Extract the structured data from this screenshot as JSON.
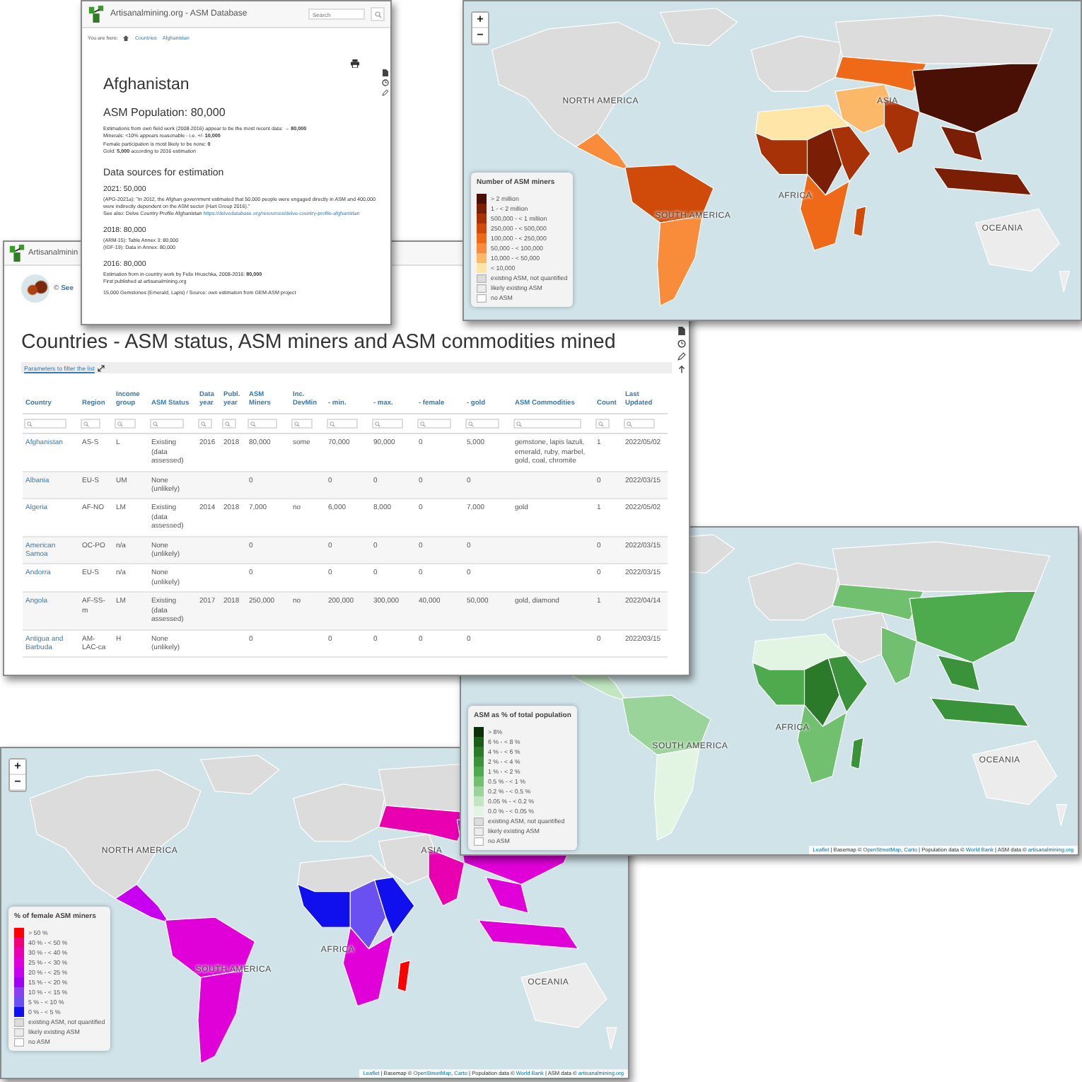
{
  "afghanistan_window": {
    "header": {
      "title": "Artisanalmining.org - ASM Database",
      "search_placeholder": "Search"
    },
    "breadcrumb": {
      "label": "You are here:",
      "links": [
        "Countries",
        "Afghanistan"
      ]
    },
    "heading": "Afghanistan",
    "population_heading": "ASM Population: 80,000",
    "summary": [
      "Estimations from own field work (2008-2016) appear to be the most recent data: → **80,000**",
      "Minerals: <10% appears reasonable - i.e. +/- **10,000**",
      "Female participation is most likely to be none: **0**",
      "Gold: **5,000** according to 2016 estimation"
    ],
    "sources_heading": "Data sources for estimation",
    "sources": [
      {
        "heading": "2021: 50,000",
        "lines": [
          {
            "text": "(APG-2021a): \"In 2012, the Afghan government estimated that 50,000 people were engaged directly in ASM and 400,000 were indirectly dependent on the ASM sector (Hart Group 2016).\""
          },
          {
            "text": "See also: Delve Country Profile Afghanistan",
            "link": "https://delvedatabase.org/resources/delve-country-profile-afghanistan"
          }
        ]
      },
      {
        "heading": "2018: 80,000",
        "lines": [
          {
            "text": "(ARM-15): Table Annex 3: 80,000"
          },
          {
            "text": "(IGF-19): Data in Annex: 80,000"
          }
        ]
      },
      {
        "heading": "2016: 80,000",
        "lines": [
          {
            "text": "Estimation from in-country work by Felix Hruschka, 2008-2016: **80,000**"
          },
          {
            "text": "First published at artisanalmining.org"
          }
        ]
      }
    ],
    "footnote": "15,000 Gemstones (Emerald, Lapis) / Source: own estimation from GEM-ASM project"
  },
  "maps": [
    {
      "kind": "miners",
      "zoom_controls": [
        "+",
        "−"
      ],
      "labels": [
        {
          "kind": "north-america",
          "text": "NORTH AMERICA"
        },
        {
          "kind": "asia",
          "text": "ASIA"
        },
        {
          "kind": "south-america",
          "text": "SOUTH AMERICA"
        },
        {
          "kind": "africa",
          "text": "AFRICA"
        },
        {
          "kind": "oceania",
          "text": "OCEANIA"
        }
      ],
      "legend": {
        "title": "Number of ASM miners",
        "items": [
          {
            "label": "> 2 million",
            "color": "#4a1005"
          },
          {
            "label": "1 - < 2 million",
            "color": "#7a1f05"
          },
          {
            "label": "500,000 - < 1 million",
            "color": "#a83208"
          },
          {
            "label": "250,000 - < 500,000",
            "color": "#d04a0a"
          },
          {
            "label": "100,000 - < 250,000",
            "color": "#ef6a18"
          },
          {
            "label": "50,000 - < 100,000",
            "color": "#f88c3a"
          },
          {
            "label": "10,000 - < 50,000",
            "color": "#fbb868"
          },
          {
            "label": "< 10,000",
            "color": "#fde6a8"
          },
          {
            "label": "existing ASM, not quantified",
            "color": "#dcdcdc"
          },
          {
            "label": "likely existing ASM",
            "color": "#ececec"
          },
          {
            "label": "no ASM",
            "color": "#ffffff"
          }
        ]
      }
    },
    {
      "kind": "countries_window"
    },
    {
      "kind": "population",
      "labels": [
        {
          "kind": "south-america",
          "text": "SOUTH AMERICA"
        },
        {
          "kind": "africa",
          "text": "AFRICA"
        },
        {
          "kind": "oceania",
          "text": "OCEANIA"
        }
      ],
      "legend": {
        "title": "ASM as % of total population",
        "items": [
          {
            "label": "> 8%",
            "color": "#0b2f0b"
          },
          {
            "label": "6 % - < 8 %",
            "color": "#1a5c1a"
          },
          {
            "label": "4 % - < 6 %",
            "color": "#2a7a2a"
          },
          {
            "label": "2 % - < 4 %",
            "color": "#3a923a"
          },
          {
            "label": "1 % - < 2 %",
            "color": "#4daa4d"
          },
          {
            "label": "0.5 % - < 1 %",
            "color": "#70c070"
          },
          {
            "label": "0.2 % - < 0.5 %",
            "color": "#9bd49b"
          },
          {
            "label": "0.05 % - < 0.2 %",
            "color": "#c2e6c2"
          },
          {
            "label": "0.0 % - < 0.05 %",
            "color": "#e2f4e2"
          },
          {
            "label": "existing ASM, not quantified",
            "color": "#dcdcdc"
          },
          {
            "label": "likely existing ASM",
            "color": "#ececec"
          },
          {
            "label": "no ASM",
            "color": "#ffffff"
          }
        ]
      },
      "attribution": [
        {
          "link": "Leaflet"
        },
        {
          "prefix": " | Basemap © ",
          "link": "OpenStreetMap"
        },
        {
          "prefix": ", ",
          "link": "Carto"
        },
        {
          "prefix": " | Population data © ",
          "link": "World Bank"
        },
        {
          "prefix": " | ASM data © ",
          "link": "artisanalmining.org"
        }
      ]
    },
    {
      "kind": "female",
      "zoom_controls": [
        "+",
        "−"
      ],
      "labels": [
        {
          "kind": "north-america",
          "text": "NORTH AMERICA"
        },
        {
          "kind": "asia",
          "text": "ASIA"
        },
        {
          "kind": "africa",
          "text": "AFRICA"
        },
        {
          "kind": "south-america",
          "text": "SOUTH AMERICA"
        },
        {
          "kind": "oceania",
          "text": "OCEANIA"
        }
      ],
      "legend": {
        "title": "% of female ASM miners",
        "items": [
          {
            "label": "> 50 %",
            "color": "#ff0000"
          },
          {
            "label": "40 % - < 50 %",
            "color": "#f0007a"
          },
          {
            "label": "30 % - < 40 %",
            "color": "#e800b0"
          },
          {
            "label": "25 % - < 30 %",
            "color": "#e000d8"
          },
          {
            "label": "20 % - < 25 %",
            "color": "#c800f0"
          },
          {
            "label": "15 % - < 20 %",
            "color": "#a000f0"
          },
          {
            "label": "10 % - < 15 %",
            "color": "#8a40f0"
          },
          {
            "label": "5 % - < 10 %",
            "color": "#6a50f0"
          },
          {
            "label": "0 % - < 5 %",
            "color": "#1010ee"
          },
          {
            "label": "existing ASM, not quantified",
            "color": "#dcdcdc"
          },
          {
            "label": "likely existing ASM",
            "color": "#ececec"
          },
          {
            "label": "no ASM",
            "color": "#ffffff"
          }
        ]
      },
      "attribution": [
        {
          "link": "Leaflet"
        },
        {
          "prefix": " | Basemap © ",
          "link": "OpenStreetMap"
        },
        {
          "prefix": ", ",
          "link": "Carto"
        },
        {
          "prefix": " | Population data © ",
          "link": "World Bank"
        },
        {
          "prefix": " | ASM data © ",
          "link": "artisanalmining.org"
        }
      ]
    }
  ],
  "countries_window": {
    "site_title": "Artisanalminin",
    "credit": "© **See**",
    "title": "Countries - ASM status, ASM miners and ASM commodities mined",
    "filter_link": "Parameters to filter the list",
    "columns": [
      "Country",
      "Region",
      "Income group",
      "ASM Status",
      "Data year",
      "Publ. year",
      "ASM Miners",
      "Inc. DevMin",
      "- min.",
      "- max.",
      "- female",
      "- gold",
      "ASM Commodities",
      "Count",
      "Last Updated"
    ],
    "rows": [
      [
        "Afghanistan",
        "AS-S",
        "L",
        "Existing (data assessed)",
        "2016",
        "2018",
        "80,000",
        "some",
        "70,000",
        "90,000",
        "0",
        "5,000",
        "gemstone, lapis lazuli, emerald, ruby, marbel, gold, coal, chromite",
        "1",
        "2022/05/02"
      ],
      [
        "Albania",
        "EU-S",
        "UM",
        "None (unlikely)",
        null,
        null,
        "0",
        null,
        "0",
        "0",
        "0",
        "0",
        null,
        "0",
        "2022/03/15"
      ],
      [
        "Algeria",
        "AF-NO",
        "LM",
        "Existing (data assessed)",
        "2014",
        "2018",
        "7,000",
        "no",
        "6,000",
        "8,000",
        "0",
        "7,000",
        "gold",
        "1",
        "2022/05/02"
      ],
      [
        "American Samoa",
        "OC-PO",
        "n/a",
        "None (unlikely)",
        null,
        null,
        "0",
        null,
        "0",
        "0",
        "0",
        "0",
        null,
        "0",
        "2022/03/15"
      ],
      [
        "Andorra",
        "EU-S",
        "n/a",
        "None (unlikely)",
        null,
        null,
        "0",
        null,
        "0",
        "0",
        "0",
        "0",
        null,
        "0",
        "2022/03/15"
      ],
      [
        "Angola",
        "AF-SS-m",
        "LM",
        "Existing (data assessed)",
        "2017",
        "2018",
        "250,000",
        "no",
        "200,000",
        "300,000",
        "40,000",
        "50,000",
        "gold, diamond",
        "1",
        "2022/04/14"
      ],
      [
        "Antigua and Barbuda",
        "AM-LAC-ca",
        "H",
        "None (unlikely)",
        null,
        null,
        "0",
        null,
        "0",
        "0",
        "0",
        "0",
        null,
        "0",
        "2022/03/15"
      ]
    ]
  }
}
